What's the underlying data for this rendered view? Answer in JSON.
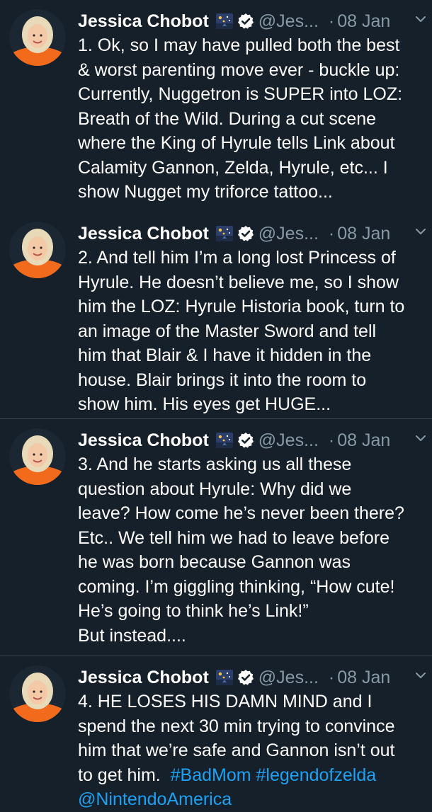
{
  "tweets": [
    {
      "name": "Jessica Chobot",
      "handle": "@Jes...",
      "dot": "·",
      "date": "08 Jan",
      "text": "1. Ok, so I may have pulled both the best\n& worst parenting move ever - buckle up:\nCurrently, Nuggetron is SUPER into LOZ:\nBreath of the Wild. During a cut scene\nwhere the King of Hyrule tells Link about\nCalamity Gannon, Zelda, Hyrule, etc... I\nshow Nugget my triforce tattoo..."
    },
    {
      "name": "Jessica Chobot",
      "handle": "@Jes...",
      "dot": "·",
      "date": "08 Jan",
      "text": "2. And tell him I’m a long lost Princess of\nHyrule. He doesn’t believe me, so I show\nhim the LOZ: Hyrule Historia book, turn to\nan image of the Master Sword and tell\nhim that Blair & I have it hidden in the\nhouse. Blair brings it into the room to\nshow him. His eyes get HUGE..."
    },
    {
      "name": "Jessica Chobot",
      "handle": "@Jes...",
      "dot": "·",
      "date": "08 Jan",
      "text": "3. And he starts asking us all these\nquestion about Hyrule: Why did we\nleave? How come he’s never been there?\nEtc.. We tell him we had to leave before\nhe was born because Gannon was\ncoming. I’m giggling thinking, “How cute!\nHe’s going to think he’s Link!”\nBut instead...."
    },
    {
      "name": "Jessica Chobot",
      "handle": "@Jes...",
      "dot": "·",
      "date": "08 Jan",
      "text": "4. HE LOSES HIS DAMN MIND and I\nspend the next 30 min trying to convince\nhim that we’re safe and Gannon isn’t out\nto get him.  ",
      "hashtag1": "#BadMom",
      "space": " ",
      "hashtag2": "#legendofzelda",
      "mention": "@NintendoAmerica"
    }
  ],
  "colors": {
    "background": "#15202b",
    "text": "#ffffff",
    "secondary": "#8899a6",
    "link": "#1da1f2",
    "divider": "#38444d",
    "verified_badge": "#ffffff",
    "avatar_jacket": "#f26b1d",
    "avatar_hair": "#e8d9b8"
  },
  "icons": [
    "avatar",
    "night-sky-emoji-icon",
    "verified-badge-icon",
    "chevron-down-icon"
  ]
}
